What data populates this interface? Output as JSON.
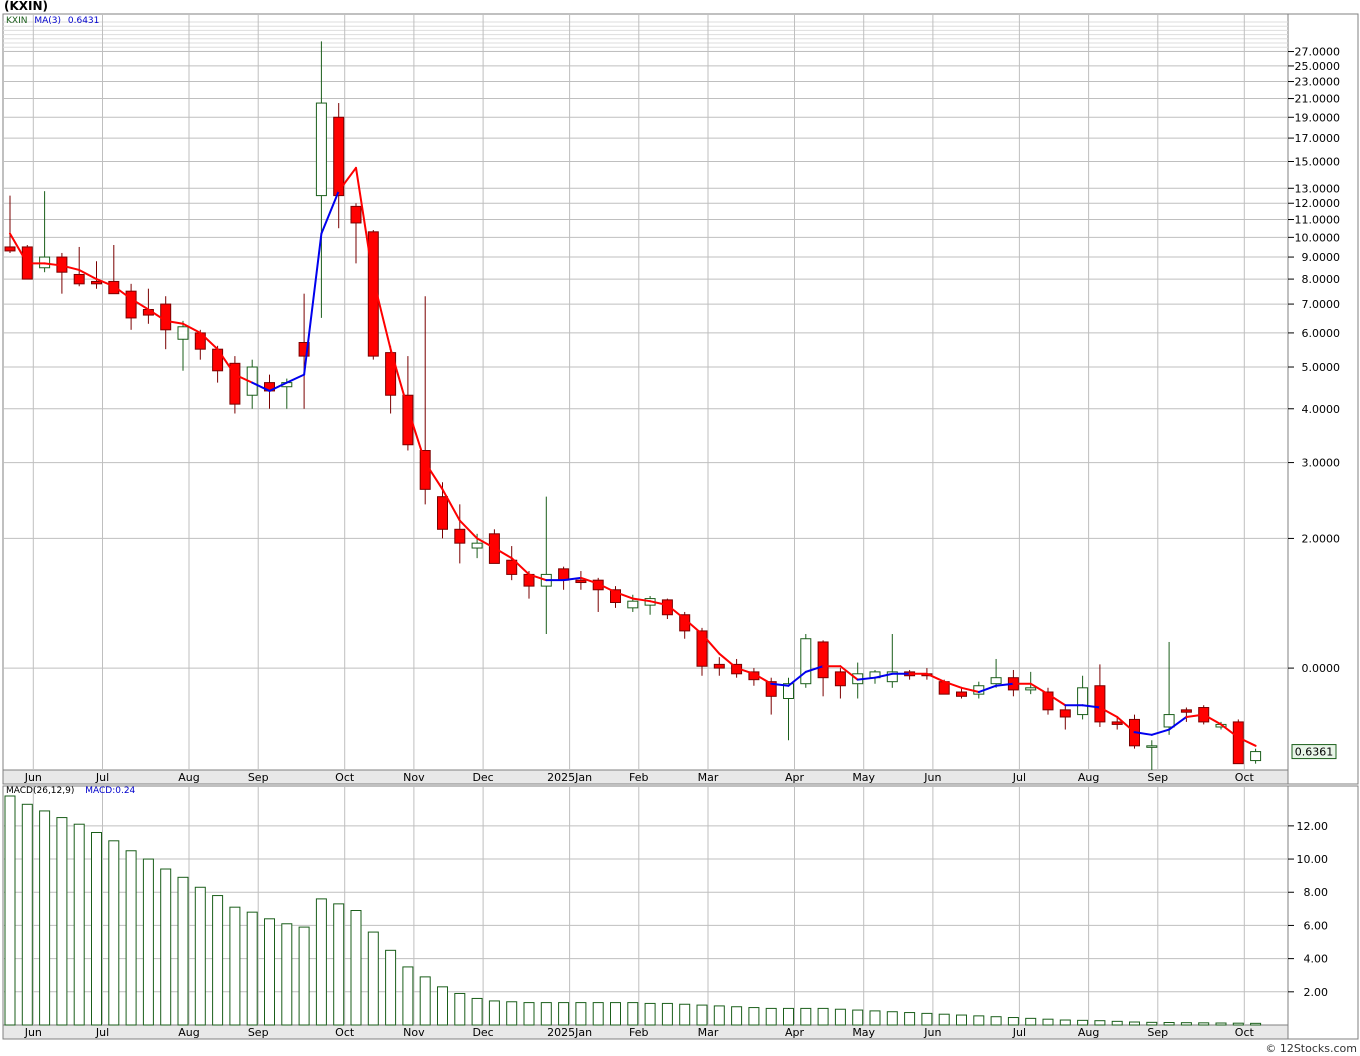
{
  "title": "(KXIN)",
  "credit": "© 12Stocks.com",
  "colors": {
    "up": "#1a5e1a",
    "down": "#ff0000",
    "ma_up": "#0000ee",
    "ma_down": "#ff0000",
    "macd": "#1a5e1a",
    "grid": "#bfbfbf",
    "frame": "#808080",
    "axis_bg": "#e8e8e8"
  },
  "price_legend": {
    "symbol": "KXIN",
    "ma_label": "MA(3)",
    "ma_value": "0.6431"
  },
  "macd_legend": {
    "label": "MACD(26,12,9)",
    "value_label": "MACD:0.24"
  },
  "last_price_label": "0.6361",
  "chart_data": [
    {
      "type": "candlestick",
      "title": "(KXIN)",
      "y_scale": "log",
      "ylim": [
        0.58,
        33
      ],
      "y_tick_labels": [
        "27.0000",
        "25.0000",
        "23.0000",
        "21.0000",
        "19.0000",
        "17.0000",
        "15.0000",
        "13.0000",
        "12.0000",
        "11.0000",
        "10.0000",
        "9.0000",
        "8.0000",
        "7.0000",
        "6.0000",
        "5.0000",
        "4.0000",
        "3.0000",
        "2.0000",
        "0.0000"
      ],
      "y_tick_values": [
        27,
        25,
        23,
        21,
        19,
        17,
        15,
        13,
        12,
        11,
        10,
        9,
        8,
        7,
        6,
        5,
        4,
        3,
        2,
        1
      ],
      "x_tick_labels": [
        {
          "label": "Jun",
          "week": 1
        },
        {
          "label": "Jul",
          "week": 5
        },
        {
          "label": "Aug",
          "week": 10
        },
        {
          "label": "Sep",
          "week": 14
        },
        {
          "label": "Oct",
          "week": 19
        },
        {
          "label": "Nov",
          "week": 23
        },
        {
          "label": "Dec",
          "week": 27
        },
        {
          "label": "2025Jan",
          "week": 32
        },
        {
          "label": "Feb",
          "week": 36
        },
        {
          "label": "Mar",
          "week": 40
        },
        {
          "label": "Apr",
          "week": 45
        },
        {
          "label": "May",
          "week": 49
        },
        {
          "label": "Jun",
          "week": 53
        },
        {
          "label": "Jul",
          "week": 58
        },
        {
          "label": "Aug",
          "week": 62
        },
        {
          "label": "Sep",
          "week": 66
        },
        {
          "label": "Oct",
          "week": 71
        }
      ],
      "candles": [
        {
          "o": 9.5,
          "h": 12.5,
          "l": 9.2,
          "c": 9.3
        },
        {
          "o": 9.5,
          "h": 9.6,
          "l": 8.0,
          "c": 8.0
        },
        {
          "o": 8.5,
          "h": 12.8,
          "l": 8.3,
          "c": 9.0
        },
        {
          "o": 9.0,
          "h": 9.2,
          "l": 7.4,
          "c": 8.3
        },
        {
          "o": 8.2,
          "h": 9.5,
          "l": 7.7,
          "c": 7.8
        },
        {
          "o": 7.9,
          "h": 8.8,
          "l": 7.6,
          "c": 7.8
        },
        {
          "o": 7.9,
          "h": 9.6,
          "l": 7.4,
          "c": 7.4
        },
        {
          "o": 7.5,
          "h": 7.8,
          "l": 6.1,
          "c": 6.5
        },
        {
          "o": 6.8,
          "h": 7.6,
          "l": 6.3,
          "c": 6.6
        },
        {
          "o": 7.0,
          "h": 7.3,
          "l": 5.5,
          "c": 6.1
        },
        {
          "o": 5.8,
          "h": 6.4,
          "l": 4.9,
          "c": 6.2
        },
        {
          "o": 6.0,
          "h": 6.1,
          "l": 5.2,
          "c": 5.5
        },
        {
          "o": 5.5,
          "h": 5.6,
          "l": 4.6,
          "c": 4.9
        },
        {
          "o": 5.1,
          "h": 5.3,
          "l": 3.9,
          "c": 4.1
        },
        {
          "o": 4.3,
          "h": 5.2,
          "l": 4.0,
          "c": 5.0
        },
        {
          "o": 4.6,
          "h": 4.8,
          "l": 4.0,
          "c": 4.4
        },
        {
          "o": 4.5,
          "h": 4.7,
          "l": 4.0,
          "c": 4.6
        },
        {
          "o": 5.7,
          "h": 7.4,
          "l": 4.0,
          "c": 5.3
        },
        {
          "o": 12.5,
          "h": 28.5,
          "l": 6.5,
          "c": 20.5
        },
        {
          "o": 19.0,
          "h": 20.5,
          "l": 10.5,
          "c": 12.5
        },
        {
          "o": 11.8,
          "h": 12.0,
          "l": 8.7,
          "c": 10.8
        },
        {
          "o": 10.3,
          "h": 10.4,
          "l": 5.2,
          "c": 5.3
        },
        {
          "o": 5.4,
          "h": 5.6,
          "l": 3.9,
          "c": 4.3
        },
        {
          "o": 4.3,
          "h": 5.3,
          "l": 3.2,
          "c": 3.3
        },
        {
          "o": 3.2,
          "h": 7.3,
          "l": 2.4,
          "c": 2.6
        },
        {
          "o": 2.5,
          "h": 2.7,
          "l": 2.0,
          "c": 2.1
        },
        {
          "o": 2.1,
          "h": 2.4,
          "l": 1.75,
          "c": 1.95
        },
        {
          "o": 1.9,
          "h": 2.05,
          "l": 1.8,
          "c": 1.95
        },
        {
          "o": 2.05,
          "h": 2.1,
          "l": 1.75,
          "c": 1.75
        },
        {
          "o": 1.78,
          "h": 1.92,
          "l": 1.6,
          "c": 1.65
        },
        {
          "o": 1.65,
          "h": 1.68,
          "l": 1.45,
          "c": 1.55
        },
        {
          "o": 1.55,
          "h": 2.5,
          "l": 1.2,
          "c": 1.65
        },
        {
          "o": 1.7,
          "h": 1.72,
          "l": 1.52,
          "c": 1.6
        },
        {
          "o": 1.6,
          "h": 1.68,
          "l": 1.52,
          "c": 1.58
        },
        {
          "o": 1.6,
          "h": 1.62,
          "l": 1.35,
          "c": 1.52
        },
        {
          "o": 1.52,
          "h": 1.55,
          "l": 1.38,
          "c": 1.42
        },
        {
          "o": 1.38,
          "h": 1.48,
          "l": 1.35,
          "c": 1.43
        },
        {
          "o": 1.4,
          "h": 1.47,
          "l": 1.33,
          "c": 1.45
        },
        {
          "o": 1.44,
          "h": 1.45,
          "l": 1.3,
          "c": 1.33
        },
        {
          "o": 1.33,
          "h": 1.35,
          "l": 1.17,
          "c": 1.22
        },
        {
          "o": 1.22,
          "h": 1.24,
          "l": 0.96,
          "c": 1.01
        },
        {
          "o": 1.02,
          "h": 1.06,
          "l": 0.96,
          "c": 1.0
        },
        {
          "o": 1.02,
          "h": 1.05,
          "l": 0.95,
          "c": 0.97
        },
        {
          "o": 0.98,
          "h": 1.0,
          "l": 0.91,
          "c": 0.94
        },
        {
          "o": 0.93,
          "h": 0.95,
          "l": 0.78,
          "c": 0.86
        },
        {
          "o": 0.85,
          "h": 0.95,
          "l": 0.68,
          "c": 0.92
        },
        {
          "o": 0.92,
          "h": 1.2,
          "l": 0.9,
          "c": 1.17
        },
        {
          "o": 1.15,
          "h": 1.16,
          "l": 0.86,
          "c": 0.95
        },
        {
          "o": 0.98,
          "h": 1.0,
          "l": 0.85,
          "c": 0.91
        },
        {
          "o": 0.92,
          "h": 1.03,
          "l": 0.85,
          "c": 0.97
        },
        {
          "o": 0.95,
          "h": 0.99,
          "l": 0.92,
          "c": 0.98
        },
        {
          "o": 0.93,
          "h": 1.2,
          "l": 0.9,
          "c": 0.98
        },
        {
          "o": 0.98,
          "h": 0.99,
          "l": 0.94,
          "c": 0.96
        },
        {
          "o": 0.97,
          "h": 1.0,
          "l": 0.94,
          "c": 0.96
        },
        {
          "o": 0.93,
          "h": 0.94,
          "l": 0.87,
          "c": 0.87
        },
        {
          "o": 0.88,
          "h": 0.9,
          "l": 0.85,
          "c": 0.86
        },
        {
          "o": 0.87,
          "h": 0.93,
          "l": 0.85,
          "c": 0.91
        },
        {
          "o": 0.92,
          "h": 1.05,
          "l": 0.9,
          "c": 0.95
        },
        {
          "o": 0.95,
          "h": 0.99,
          "l": 0.86,
          "c": 0.89
        },
        {
          "o": 0.89,
          "h": 0.98,
          "l": 0.87,
          "c": 0.9
        },
        {
          "o": 0.88,
          "h": 0.9,
          "l": 0.78,
          "c": 0.8
        },
        {
          "o": 0.8,
          "h": 0.82,
          "l": 0.72,
          "c": 0.77
        },
        {
          "o": 0.78,
          "h": 0.96,
          "l": 0.76,
          "c": 0.9
        },
        {
          "o": 0.91,
          "h": 1.02,
          "l": 0.73,
          "c": 0.75
        },
        {
          "o": 0.75,
          "h": 0.77,
          "l": 0.72,
          "c": 0.74
        },
        {
          "o": 0.76,
          "h": 0.78,
          "l": 0.65,
          "c": 0.66
        },
        {
          "o": 0.66,
          "h": 0.68,
          "l": 0.58,
          "c": 0.66
        },
        {
          "o": 0.73,
          "h": 1.15,
          "l": 0.7,
          "c": 0.78
        },
        {
          "o": 0.8,
          "h": 0.81,
          "l": 0.75,
          "c": 0.79
        },
        {
          "o": 0.81,
          "h": 0.82,
          "l": 0.74,
          "c": 0.75
        },
        {
          "o": 0.73,
          "h": 0.75,
          "l": 0.72,
          "c": 0.74
        },
        {
          "o": 0.75,
          "h": 0.76,
          "l": 0.6,
          "c": 0.6
        },
        {
          "o": 0.61,
          "h": 0.65,
          "l": 0.6,
          "c": 0.64
        }
      ],
      "ma3": [
        10.2,
        8.7,
        8.7,
        8.6,
        8.4,
        8.0,
        7.7,
        7.2,
        6.8,
        6.4,
        6.3,
        6.0,
        5.5,
        4.8,
        4.6,
        4.4,
        4.6,
        4.8,
        10.2,
        12.8,
        14.5,
        8.0,
        5.5,
        4.0,
        3.0,
        2.6,
        2.2,
        2.0,
        1.9,
        1.8,
        1.65,
        1.6,
        1.6,
        1.62,
        1.57,
        1.5,
        1.45,
        1.43,
        1.4,
        1.3,
        1.2,
        1.08,
        1.0,
        0.97,
        0.92,
        0.91,
        0.98,
        1.01,
        1.01,
        0.94,
        0.95,
        0.97,
        0.97,
        0.97,
        0.93,
        0.9,
        0.88,
        0.91,
        0.92,
        0.92,
        0.87,
        0.82,
        0.82,
        0.81,
        0.77,
        0.71,
        0.7,
        0.72,
        0.77,
        0.78,
        0.74,
        0.69,
        0.66
      ],
      "ma_last_up_weeks": [
        15,
        16,
        17,
        18,
        19,
        32,
        33,
        45,
        46,
        47,
        50,
        51,
        52,
        57,
        58,
        62,
        63,
        66,
        67,
        68
      ]
    },
    {
      "type": "bar",
      "title": "MACD(26,12,9)",
      "ylim": [
        0,
        13.8
      ],
      "y_tick_labels": [
        "12.00",
        "10.00",
        "8.00",
        "6.00",
        "4.00",
        "2.00"
      ],
      "y_tick_values": [
        12,
        10,
        8,
        6,
        4,
        2
      ],
      "values": [
        13.8,
        13.3,
        12.9,
        12.5,
        12.1,
        11.6,
        11.1,
        10.5,
        10.0,
        9.4,
        8.9,
        8.3,
        7.8,
        7.1,
        6.8,
        6.4,
        6.1,
        5.9,
        7.6,
        7.3,
        6.9,
        5.6,
        4.5,
        3.5,
        2.9,
        2.3,
        1.9,
        1.6,
        1.45,
        1.4,
        1.35,
        1.35,
        1.35,
        1.35,
        1.35,
        1.35,
        1.35,
        1.3,
        1.3,
        1.25,
        1.2,
        1.15,
        1.1,
        1.05,
        1.0,
        1.0,
        1.0,
        1.0,
        0.95,
        0.9,
        0.85,
        0.8,
        0.75,
        0.7,
        0.65,
        0.6,
        0.55,
        0.5,
        0.45,
        0.4,
        0.35,
        0.3,
        0.28,
        0.26,
        0.22,
        0.18,
        0.16,
        0.15,
        0.14,
        0.13,
        0.12,
        0.11,
        0.1
      ]
    }
  ]
}
